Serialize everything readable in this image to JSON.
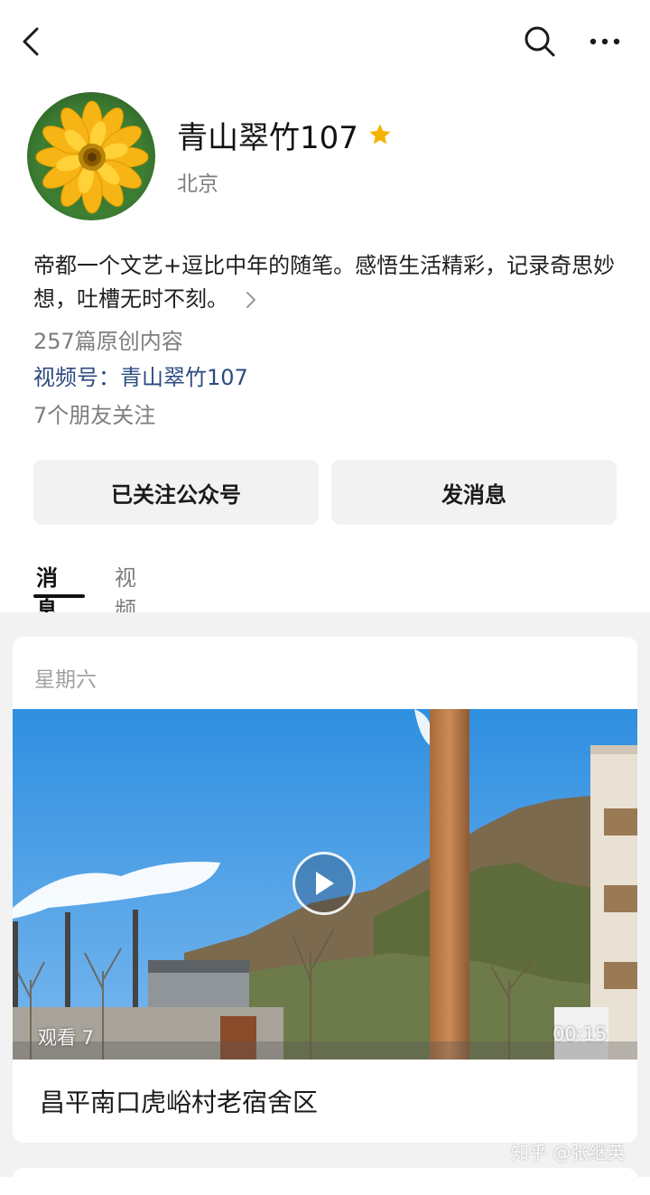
{
  "header": {
    "back_icon": "chevron-left-icon",
    "search_icon": "search-icon",
    "more_icon": "more-dots-icon"
  },
  "profile": {
    "name": "青山翠竹107",
    "location": "北京",
    "bio": "帝都一个文艺+逗比中年的随笔。感悟生活精彩，记录奇思妙想，吐槽无时不刻。",
    "articles": "257篇原创内容",
    "video_account": "视频号：青山翠竹107",
    "friends_following": "7个朋友关注"
  },
  "actions": {
    "follow_label": "已关注公众号",
    "message_label": "发消息"
  },
  "tabs": [
    {
      "label": "消息",
      "active": true
    },
    {
      "label": "视频号",
      "active": false
    }
  ],
  "feed": {
    "day": "星期六",
    "video": {
      "views": "观看 7",
      "duration": "00:15",
      "title": "昌平南口虎峪村老宿舍区"
    }
  },
  "watermark": "知乎 @张继英",
  "colors": {
    "link": "#2c4b80",
    "star": "#f5b301",
    "secondary_text": "#7d7d7d"
  }
}
